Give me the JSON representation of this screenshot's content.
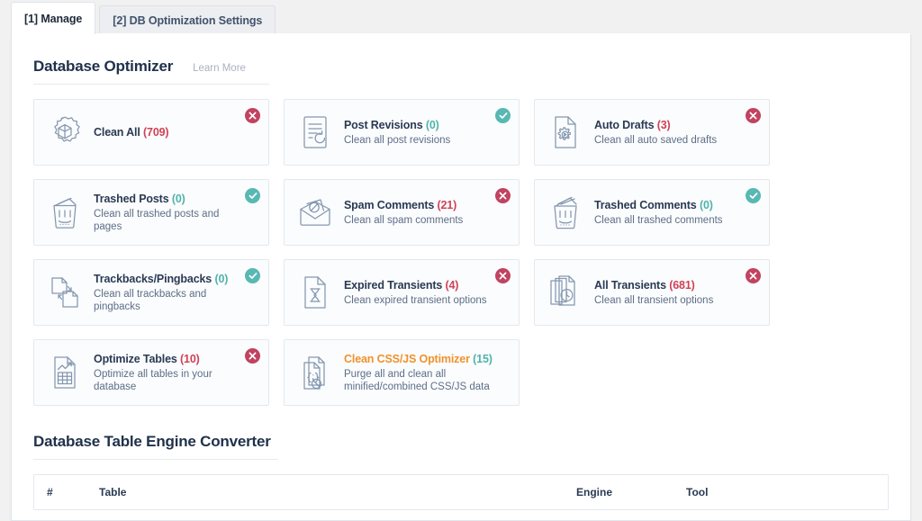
{
  "tabs": [
    {
      "label": "[1] Manage",
      "active": true
    },
    {
      "label": "[2] DB Optimization Settings",
      "active": false
    }
  ],
  "optimizer": {
    "title": "Database Optimizer",
    "learn_more": "Learn More",
    "cards": [
      {
        "icon": "gear-cube-icon",
        "title": "Clean All",
        "count": "(709)",
        "count_color": "red",
        "desc": "",
        "badge": "red-x",
        "accent": false
      },
      {
        "icon": "post-revisions-icon",
        "title": "Post Revisions",
        "count": "(0)",
        "count_color": "teal",
        "desc": "Clean all post revisions",
        "badge": "teal-check",
        "accent": false
      },
      {
        "icon": "auto-drafts-icon",
        "title": "Auto Drafts",
        "count": "(3)",
        "count_color": "red",
        "desc": "Clean all auto saved drafts",
        "badge": "red-x",
        "accent": false
      },
      {
        "icon": "trash-posts-icon",
        "title": "Trashed Posts",
        "count": "(0)",
        "count_color": "teal",
        "desc": "Clean all trashed posts and pages",
        "badge": "teal-check",
        "accent": false
      },
      {
        "icon": "spam-envelope-icon",
        "title": "Spam Comments",
        "count": "(21)",
        "count_color": "red",
        "desc": "Clean all spam comments",
        "badge": "red-x",
        "accent": false
      },
      {
        "icon": "trash-comments-icon",
        "title": "Trashed Comments",
        "count": "(0)",
        "count_color": "teal",
        "desc": "Clean all trashed comments",
        "badge": "teal-check",
        "accent": false
      },
      {
        "icon": "trackbacks-icon",
        "title": "Trackbacks/Pingbacks",
        "count": "(0)",
        "count_color": "teal",
        "desc": "Clean all trackbacks and pingbacks",
        "badge": "teal-check",
        "accent": false
      },
      {
        "icon": "hourglass-doc-icon",
        "title": "Expired Transients",
        "count": "(4)",
        "count_color": "red",
        "desc": "Clean expired transient options",
        "badge": "red-x",
        "accent": false
      },
      {
        "icon": "clock-docs-icon",
        "title": "All Transients",
        "count": "(681)",
        "count_color": "red",
        "desc": "Clean all transient options",
        "badge": "red-x",
        "accent": false
      },
      {
        "icon": "optimize-tables-icon",
        "title": "Optimize Tables",
        "count": "(10)",
        "count_color": "red",
        "desc": "Optimize all tables in your database",
        "badge": "red-x",
        "accent": false
      },
      {
        "icon": "css-js-icon",
        "title": "Clean CSS/JS Optimizer",
        "count": "(15)",
        "count_color": "teal",
        "desc": "Purge all and clean all minified/combined CSS/JS data",
        "badge": "none",
        "accent": true
      }
    ]
  },
  "converter": {
    "title": "Database Table Engine Converter",
    "columns": [
      "#",
      "Table",
      "Engine",
      "Tool"
    ]
  },
  "colors": {
    "badge_red": "#c14360",
    "badge_teal": "#58b8b3",
    "count_red": "#cf4257",
    "count_teal": "#4fb3ab",
    "accent_orange": "#f0922b",
    "icon_stroke": "#8497b0",
    "title_navy": "#2a3a53"
  }
}
